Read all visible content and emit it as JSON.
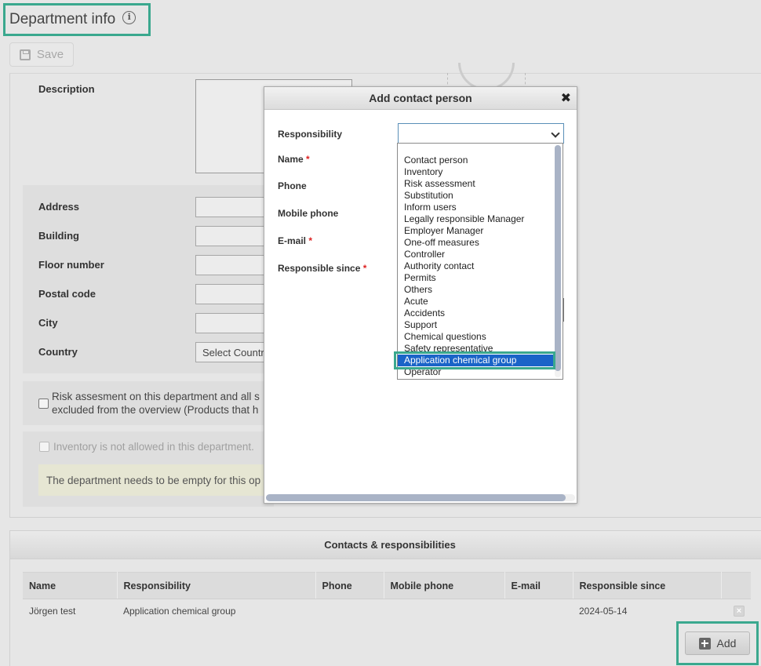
{
  "header": {
    "title": "Department info",
    "info_icon": "info-circle-icon"
  },
  "toolbar": {
    "save_label": "Save",
    "save_icon": "floppy-disk-icon"
  },
  "form": {
    "description_label": "Description",
    "address_label": "Address",
    "building_label": "Building",
    "floor_label": "Floor number",
    "postal_label": "Postal code",
    "city_label": "City",
    "country_label": "Country",
    "country_placeholder": "Select Country",
    "risk_checkbox_text_1": "Risk assesment on this department and all s",
    "risk_checkbox_text_2": "excluded from the overview (Products that h",
    "inventory_checkbox_text": "Inventory is not allowed in this department.",
    "warning_text": "The department needs to be empty for this op"
  },
  "modal": {
    "title": "Add contact person",
    "close_icon": "close-x-icon",
    "responsibility_label": "Responsibility",
    "name_label": "Name",
    "phone_label": "Phone",
    "mobile_label": "Mobile phone",
    "email_label": "E-mail",
    "since_label": "Responsible since",
    "required_mark": "*",
    "responsibility_value": ""
  },
  "dropdown": {
    "options": [
      "Contact person",
      "Inventory",
      "Risk assessment",
      "Substitution",
      "Inform users",
      "Legally responsible Manager",
      "Employer Manager",
      "One-off measures",
      "Controller",
      "Authority contact",
      "Permits",
      "Others",
      "Acute",
      "Accidents",
      "Support",
      "Chemical questions",
      "Safety representative",
      "Application chemical group",
      "Operator"
    ],
    "selected_index": 17
  },
  "contacts": {
    "section_title": "Contacts & responsibilities",
    "columns": [
      "Name",
      "Responsibility",
      "Phone",
      "Mobile phone",
      "E-mail",
      "Responsible since"
    ],
    "rows": [
      {
        "name": "Jörgen test",
        "responsibility": "Application chemical group",
        "phone": "",
        "mobile": "",
        "email": "",
        "since": "2024-05-14"
      }
    ],
    "add_label": "Add",
    "add_icon": "plus-square-icon",
    "delete_icon": "delete-x-icon"
  }
}
